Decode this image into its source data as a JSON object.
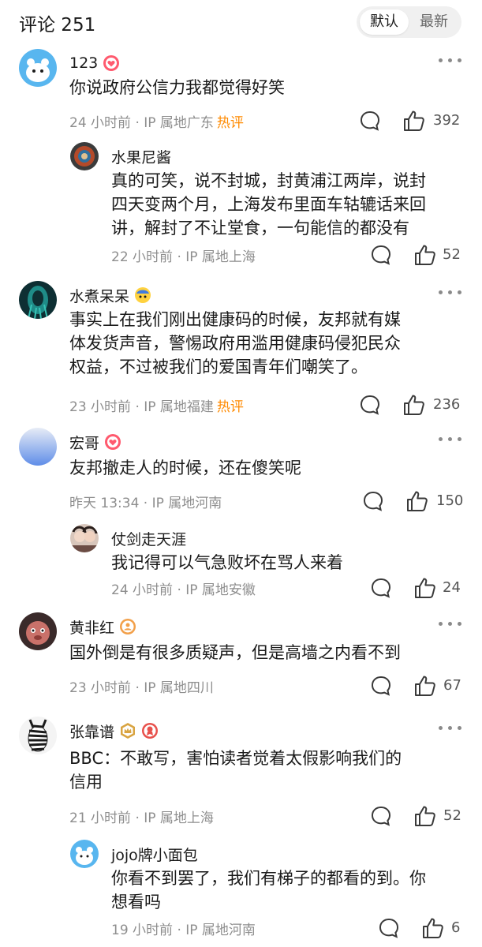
{
  "header": {
    "title": "评论 251",
    "sort_default": "默认",
    "sort_latest": "最新"
  },
  "colors": {
    "hot": "#ff8a00",
    "meta": "#8e8e8e"
  },
  "comments": [
    {
      "name": "123",
      "badges": [
        "red-heart-badge-icon"
      ],
      "content": "你说政府公信力我都觉得好笑",
      "meta": "24 小时前 · IP 属地广东",
      "hot": "热评",
      "likes": "392"
    },
    {
      "name": "水果尼酱",
      "content": "真的可笑，说不封城，封黄浦江两岸，说封\n四天变两个月，上海发布里面车轱辘话来回\n讲，解封了不让堂食，一句能信的都没有",
      "meta": "22 小时前 · IP 属地上海",
      "likes": "52"
    },
    {
      "name": "水煮呆呆",
      "badges": [
        "yellow-emoji-badge-icon"
      ],
      "content": "事实上在我们刚出健康码的时候，友邦就有媒\n体发货声音，警惕政府用滥用健康码侵犯民众\n权益，不过被我们的爱国青年们嘲笑了。",
      "meta": "23 小时前 · IP 属地福建",
      "hot": "热评",
      "likes": "236"
    },
    {
      "name": "宏哥",
      "badges": [
        "red-heart-badge-icon"
      ],
      "content": "友邦撤走人的时候，还在傻笑呢",
      "meta": "昨天 13:34 · IP 属地河南",
      "likes": "150"
    },
    {
      "name": "仗剑走天涯",
      "content": "我记得可以气急败坏在骂人来着",
      "meta": "24 小时前 · IP 属地安徽",
      "likes": "24"
    },
    {
      "name": "黄非红",
      "badges": [
        "orange-user-badge-icon"
      ],
      "content": "国外倒是有很多质疑声，但是高墙之内看不到",
      "meta": "23 小时前 · IP 属地四川",
      "likes": "67"
    },
    {
      "name": "张靠谱",
      "badges": [
        "gold-crown-badge-icon",
        "red-medal-badge-icon"
      ],
      "content": "BBC：不敢写，害怕读者觉着太假影响我们的\n信用",
      "meta": "21 小时前 · IP 属地上海",
      "likes": "52"
    },
    {
      "name": "jojo牌小面包",
      "content": "你看不到罢了，我们有梯子的都看的到。你\n想看吗",
      "meta": "19 小时前 · IP 属地河南",
      "likes": "6"
    }
  ]
}
